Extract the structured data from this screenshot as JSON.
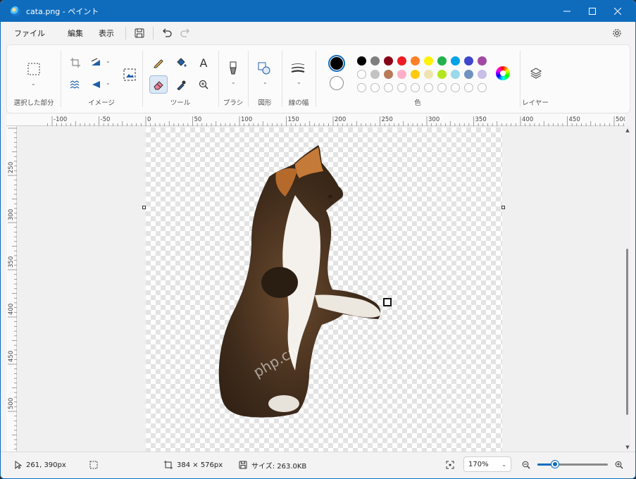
{
  "window": {
    "title": "cata.png - ペイント"
  },
  "menu": {
    "file": "ファイル",
    "edit": "編集",
    "view": "表示"
  },
  "ribbon": {
    "groups": {
      "selection": "選択した部分",
      "image": "イメージ",
      "tools": "ツール",
      "brush": "ブラシ",
      "shapes": "図形",
      "line_width": "線の幅",
      "colors": "色",
      "layers": "レイヤー"
    },
    "text_tool_glyph": "A",
    "palette_row1": [
      "#000000",
      "#7f7f7f",
      "#880015",
      "#ed1c24",
      "#ff7f27",
      "#fff200",
      "#22b14c",
      "#00a2e8",
      "#3f48cc",
      "#a349a4"
    ],
    "palette_row2": [
      "#ffffff",
      "#c3c3c3",
      "#b97a57",
      "#ffaec9",
      "#ffc90e",
      "#efe4b0",
      "#b5e61d",
      "#99d9ea",
      "#7092be",
      "#c8bfe7"
    ],
    "primary_color": "#000000",
    "secondary_color": "#ffffff",
    "accent": "#0f6cbd"
  },
  "rulers": {
    "top": [
      "-100",
      "-50",
      "0",
      "50",
      "100",
      "150",
      "200",
      "250",
      "300",
      "350",
      "400",
      "450",
      "500"
    ],
    "left": [
      "250",
      "300",
      "350",
      "400",
      "450",
      "500"
    ]
  },
  "status": {
    "cursor": "261, 390px",
    "canvas_size": "384 × 576px",
    "file_size": "サイズ: 263.0KB",
    "zoom": "170%",
    "zoom_fraction": 0.25
  },
  "watermark": "php.cn"
}
